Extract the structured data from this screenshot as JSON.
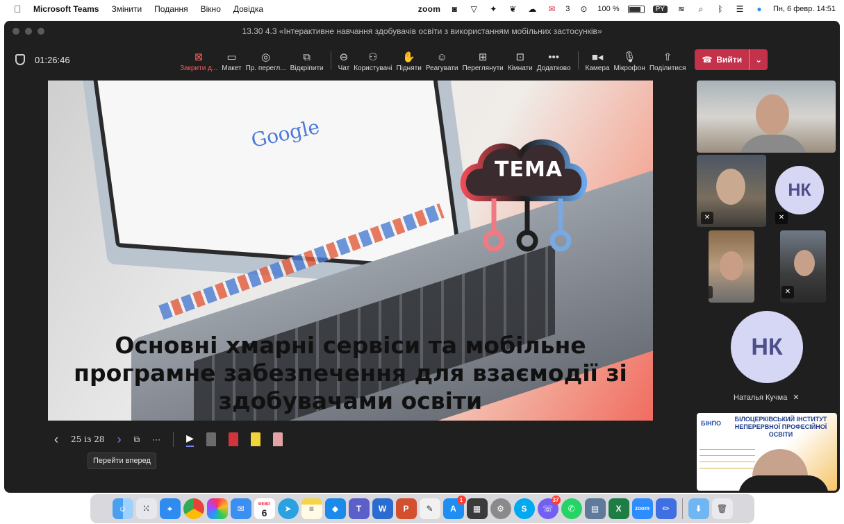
{
  "menubar": {
    "app_name": "Microsoft Teams",
    "menus": [
      "Змінити",
      "Подання",
      "Вікно",
      "Довідка"
    ],
    "zoom_label": "zoom",
    "mail_count": "3",
    "battery_percent": "100 %",
    "input_lang": "PY",
    "datetime": "Пн, 6 февр.  14:51"
  },
  "window": {
    "title": "13.30 4.3 «Інтерактивне навчання здобувачів освіти з використанням мобільних застосунків»"
  },
  "toolbar": {
    "timer": "01:26:46",
    "close_label": "Закрити д...",
    "layout_label": "Макет",
    "preview_label": "Пр. перегл...",
    "popout_label": "Відкріпити",
    "chat_label": "Чат",
    "people_label": "Користувачі",
    "raise_label": "Підняти",
    "react_label": "Реагувати",
    "view_label": "Переглянути",
    "rooms_label": "Кімнати",
    "more_label": "Додатково",
    "camera_label": "Камера",
    "mic_label": "Мікрофон",
    "share_label": "Поділитися",
    "leave_label": "Вийти"
  },
  "slide": {
    "search_logo": "Google",
    "tag": "ТЕМА",
    "title_lines": [
      "Основні хмарні сервіси та мобільне",
      "програмне забезпечення для взаємодії зі",
      "здобувачами освіти"
    ]
  },
  "slide_controls": {
    "page_indicator": "25 із 28",
    "tooltip": "Перейти вперед"
  },
  "participants": {
    "initials_1": "НК",
    "initials_2": "НК",
    "name_2": "Наталья Кучма"
  },
  "presenter_banner": {
    "logo": "БІНПО",
    "title": "БІЛОЦЕРКІВСЬКИЙ ІНСТИТУТ НЕПЕРЕРВНОЇ ПРОФЕСІЙНОЇ ОСВІТИ"
  },
  "dock": {
    "calendar_month": "ФЕВР.",
    "calendar_day": "6",
    "appstore_badge": "1",
    "viber_badge": "37"
  },
  "colors": {
    "accent": "#7f85f5",
    "leave": "#c4314b",
    "window_bg": "#1f1f1f",
    "avatar_bg": "#d6d6f5"
  }
}
